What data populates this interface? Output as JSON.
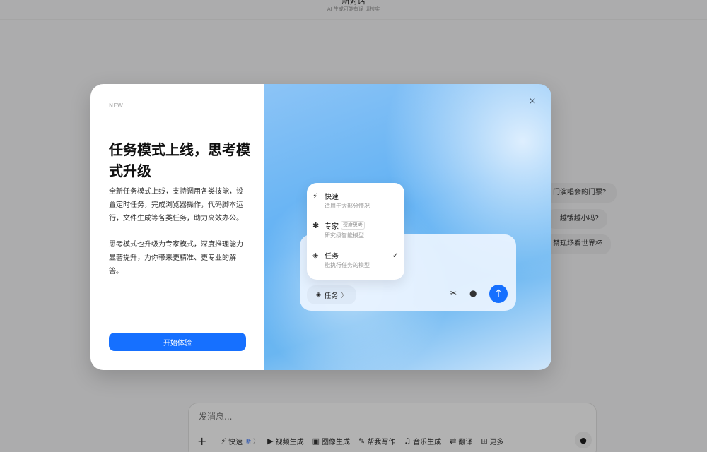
{
  "header": {
    "title": "新对话",
    "subtitle": "AI 生成可能有误 请核实"
  },
  "suggestions": [
    "门演唱会的门票?",
    "越饿越小吗?",
    "禁现场看世界杯"
  ],
  "composer": {
    "placeholder": "发消息...",
    "tools": [
      {
        "label": "快速",
        "icon": "bolt-icon",
        "glyph": "⚡",
        "badge": "新",
        "chevron": "〉"
      },
      {
        "label": "视频生成",
        "icon": "video-icon",
        "glyph": "▶"
      },
      {
        "label": "图像生成",
        "icon": "image-icon",
        "glyph": "▣"
      },
      {
        "label": "帮我写作",
        "icon": "write-icon",
        "glyph": "✎"
      },
      {
        "label": "音乐生成",
        "icon": "music-icon",
        "glyph": "♫"
      },
      {
        "label": "翻译",
        "icon": "translate-icon",
        "glyph": "⇄"
      },
      {
        "label": "更多",
        "icon": "grid-icon",
        "glyph": "⊞"
      }
    ],
    "plus": "+",
    "mic_glyph": "●"
  },
  "modal": {
    "tag": "NEW",
    "title": "任务模式上线，思考模式升级",
    "desc1": "全新任务模式上线，支持调用各类技能，设置定时任务，完成浏览器操作，代码脚本运行，文件生成等各类任务，助力高效办公。",
    "desc2": "思考模式也升级为专家模式，深度推理能力显著提升，为你带来更精准、更专业的解答。",
    "cta": "开始体验",
    "close": "×"
  },
  "mockup": {
    "modes": [
      {
        "name": "快速",
        "desc": "适用于大部分情况",
        "glyph": "⚡"
      },
      {
        "name": "专家",
        "desc": "研究级智能模型",
        "badge": "深度思考",
        "glyph": "✱"
      },
      {
        "name": "任务",
        "desc": "能执行任务的模型",
        "glyph": "◈",
        "check": "✓"
      }
    ],
    "selected_mode": "任务",
    "selected_chevron": "〉",
    "scissors_glyph": "✂",
    "mic_glyph": "●",
    "send_glyph": "↑"
  }
}
